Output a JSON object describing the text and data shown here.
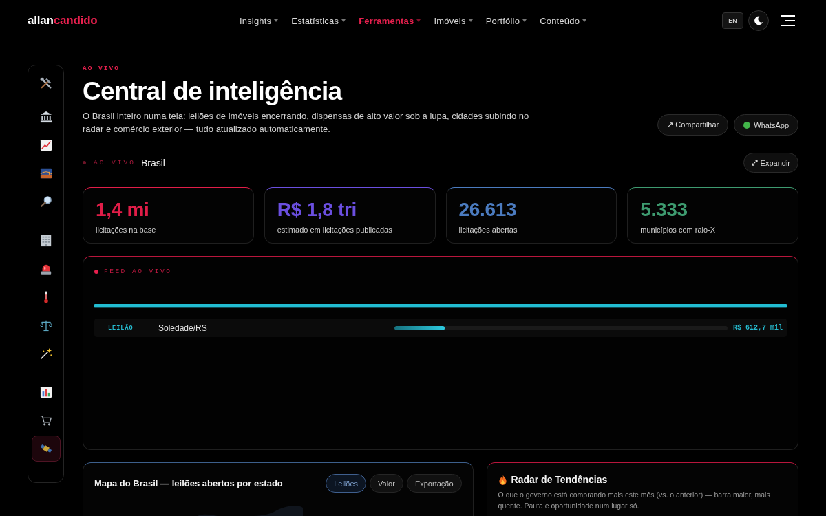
{
  "header": {
    "logo": {
      "first": "allan",
      "second": "candido"
    },
    "nav": [
      {
        "label": "Insights",
        "selected": false
      },
      {
        "label": "Estatísticas",
        "selected": false
      },
      {
        "label": "Ferramentas",
        "selected": true
      },
      {
        "label": "Imóveis",
        "selected": false
      },
      {
        "label": "Portfólio",
        "selected": false
      },
      {
        "label": "Conteúdo",
        "selected": false
      }
    ],
    "language_button": "EN"
  },
  "sidebar": {
    "groups": [
      {
        "items": [
          {
            "selected": false
          }
        ]
      },
      {
        "items": [
          {
            "selected": false
          },
          {
            "selected": false
          },
          {
            "selected": false
          },
          {
            "selected": false
          }
        ]
      },
      {
        "items": [
          {
            "selected": false
          },
          {
            "selected": false
          },
          {
            "selected": false
          },
          {
            "selected": false
          },
          {
            "selected": false
          }
        ]
      },
      {
        "items": [
          {
            "selected": false
          },
          {
            "selected": false
          },
          {
            "selected": true
          }
        ]
      }
    ]
  },
  "hero": {
    "eyebrow": "AO VIVO",
    "title": "Central de inteligência",
    "description": "O Brasil inteiro numa tela: leilões de imóveis encerrando, dispensas de alto valor sob a lupa, cidades subindo no radar e comércio exterior — tudo atualizado automaticamente.",
    "actions": [
      {
        "kind": "plain",
        "label": "↗ Compartilhar"
      },
      {
        "kind": "dot",
        "label": "WhatsApp"
      }
    ]
  },
  "live_bar": {
    "label": "AO VIVO",
    "region": "Brasil",
    "expand_button": "Expandir"
  },
  "stats": [
    {
      "value": "1,4 mi",
      "label": "licitações na base",
      "color": "#e11d48"
    },
    {
      "value": "R$ 1,8 tri",
      "label": "estimado em licitações publicadas",
      "color": "#6b4fe0"
    },
    {
      "value": "26.613",
      "label": "licitações abertas",
      "color": "#4b7bbf"
    },
    {
      "value": "5.333",
      "label": "municípios com raio-X",
      "color": "#3e9b70"
    }
  ],
  "feed": {
    "title": "FEED AO VIVO",
    "rows": [
      {
        "tag": "LEILÃO",
        "place": "Soledade/RS",
        "level": 0.15,
        "amount": "R$ 612,7 mil"
      }
    ]
  },
  "map_panel": {
    "title": "Mapa do Brasil — leilões abertos por estado",
    "tabs": [
      {
        "label": "Leilões",
        "selected": true
      },
      {
        "label": "Valor",
        "selected": false
      },
      {
        "label": "Exportação",
        "selected": false
      }
    ]
  },
  "radar_panel": {
    "title": "Radar de Tendências",
    "description": "O que o governo está comprando mais este mês (vs. o anterior) — barra maior, mais quente. Pauta e oportunidade num lugar só."
  }
}
